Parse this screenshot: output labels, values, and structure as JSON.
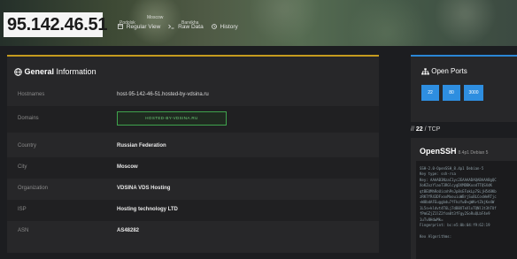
{
  "header": {
    "ip": "95.142.46.51",
    "map_labels": [
      "Moscow",
      "Podolsk",
      "Barvikha"
    ],
    "nav": [
      {
        "icon": "regular-view-icon",
        "label": "Regular View"
      },
      {
        "icon": "raw-data-icon",
        "label": "Raw Data"
      },
      {
        "icon": "history-icon",
        "label": "History"
      }
    ]
  },
  "general": {
    "title_bold": "General",
    "title_rest": " Information",
    "rows": [
      {
        "label": "Hostnames",
        "value": "host-95-142-46-51.hosted-by-vdsina.ru"
      },
      {
        "label": "Domains",
        "value": "HOSTED-BY-VDSINA.RU"
      },
      {
        "label": "Country",
        "value": "Russian Federation"
      },
      {
        "label": "City",
        "value": "Moscow"
      },
      {
        "label": "Organization",
        "value": "VDSINA VDS Hosting"
      },
      {
        "label": "ISP",
        "value": "Hosting technology LTD"
      },
      {
        "label": "ASN",
        "value": "AS48282"
      }
    ]
  },
  "ports": {
    "title": "Open Ports",
    "list": [
      "22",
      "80",
      "3000"
    ]
  },
  "service": {
    "port_label_prefix": "// ",
    "port_number": "22",
    "port_proto": " / TCP",
    "name": "OpenSSH",
    "version": "8.4p1 Debian 5",
    "banner": "SSH-2.0-OpenSSH_8.4p1 Debian-5\nKey type: ssh-rsa\nKey: AAAAB3NzaC1yc2EAAAADAQABAAABgQC\nXoKZxzYlaoT3RGlcygDXMDBKxodTTQSXdK\nqtBEUMhRoUicnhPnJp8sEFakLp7SLjH548Kb\nzRK7fR43DFxoxMoouiuWBrjSuBLCosWeRTjc\n+W8bdAFEuggbdu7fFkzYwB+gWK+tZkjKe4W\n1L5s+kldvt4T6Lj7dB8XTeXlxTQNl1t3hTUf\nfPmGZjZ1lZ2fsm0t3fFgy2SoRuQLbF4e9\n1uTv8HdwMk=\nFingerprint: bc:e5:0b:04:f9:62:19\n\nKex Algorithms:"
  },
  "colors": {
    "accent_general": "#c59b1f",
    "accent_ports": "#2a86d6",
    "port_button": "#2e8ee0",
    "domain_tag": "#3fa34d"
  }
}
